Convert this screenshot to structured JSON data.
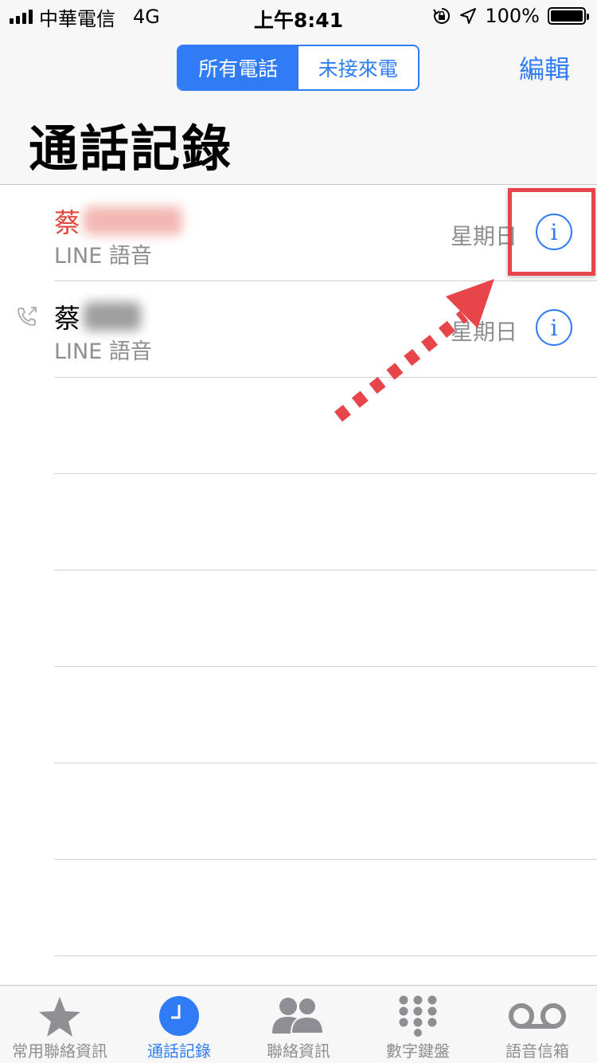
{
  "status_bar": {
    "carrier": "中華電信",
    "network": "4G",
    "time": "上午8:41",
    "battery": "100%"
  },
  "nav": {
    "segments": [
      "所有電話",
      "未接來電"
    ],
    "active_segment": 0,
    "edit_label": "編輯",
    "title": "通話記錄"
  },
  "calls": [
    {
      "name": "蔡",
      "missed": true,
      "type": "LINE 語音",
      "date": "星期日",
      "direction": "incoming"
    },
    {
      "name": "蔡",
      "missed": false,
      "type": "LINE 語音",
      "date": "星期日",
      "direction": "outgoing"
    }
  ],
  "tabs": [
    {
      "label": "常用聯絡資訊",
      "icon": "star-icon",
      "active": false
    },
    {
      "label": "通話記錄",
      "icon": "clock-icon",
      "active": true
    },
    {
      "label": "聯絡資訊",
      "icon": "contacts-icon",
      "active": false
    },
    {
      "label": "數字鍵盤",
      "icon": "keypad-icon",
      "active": false
    },
    {
      "label": "語音信箱",
      "icon": "voicemail-icon",
      "active": false
    }
  ],
  "colors": {
    "accent": "#2f7cf6",
    "missed": "#e2463a",
    "annotation": "#e8454a",
    "secondary_text": "#8e8e93"
  }
}
